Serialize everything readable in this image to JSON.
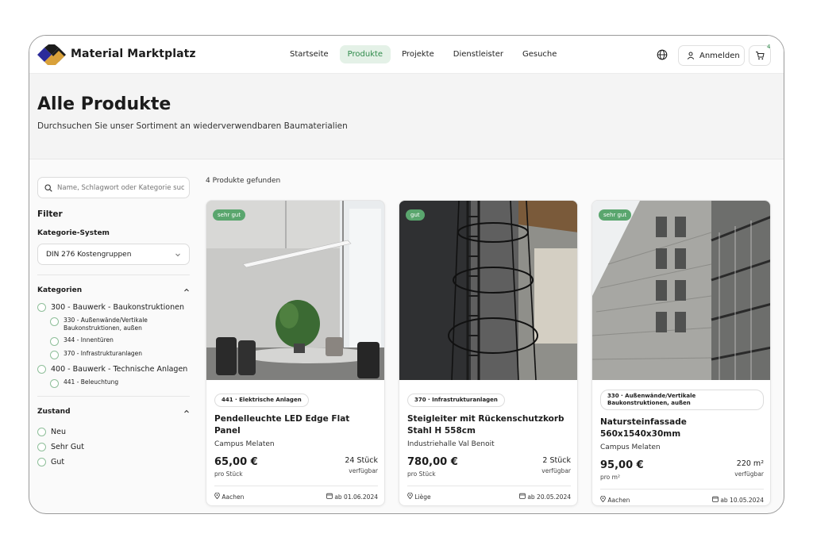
{
  "header": {
    "brand": "Material Marktplatz",
    "nav": [
      "Startseite",
      "Produkte",
      "Projekte",
      "Dienstleister",
      "Gesuche"
    ],
    "active_nav": "Produkte",
    "login_label": "Anmelden",
    "cart_count": "4"
  },
  "hero": {
    "title": "Alle Produkte",
    "subtitle": "Durchsuchen Sie unser Sortiment an wiederverwendbaren Baumaterialien"
  },
  "sidebar": {
    "search_placeholder": "Name, Schlagwort oder Kategorie suchen",
    "filter_title": "Filter",
    "system_label": "Kategorie-System",
    "system_value": "DIN 276 Kostengruppen",
    "categories_label": "Kategorien",
    "categories": [
      {
        "label": "300 - Bauwerk - Baukonstruktionen",
        "children": [
          "330 - Außenwände/Vertikale Baukonstruktionen, außen",
          "344 - Innentüren",
          "370 - Infrastrukturanlagen"
        ]
      },
      {
        "label": "400 - Bauwerk - Technische Anlagen",
        "children": [
          "441 - Beleuchtung"
        ]
      }
    ],
    "condition_label": "Zustand",
    "conditions": [
      "Neu",
      "Sehr Gut",
      "Gut"
    ]
  },
  "results": {
    "count_text": "4 Produkte gefunden",
    "products": [
      {
        "badge": "sehr gut",
        "category": "441 · Elektrische Anlagen",
        "title": "Pendelleuchte LED Edge Flat Panel",
        "location_name": "Campus Melaten",
        "price": "65,00 €",
        "unit": "pro Stück",
        "quantity": "24 Stück",
        "availability": "verfügbar",
        "city": "Aachen",
        "date": "ab 01.06.2024"
      },
      {
        "badge": "gut",
        "category": "370 · Infrastrukturanlagen",
        "title": "Steigleiter mit Rückenschutzkorb Stahl H 558cm",
        "location_name": "Industriehalle Val Benoit",
        "price": "780,00 €",
        "unit": "pro Stück",
        "quantity": "2 Stück",
        "availability": "verfügbar",
        "city": "Liège",
        "date": "ab 20.05.2024"
      },
      {
        "badge": "sehr gut",
        "category": "330 · Außenwände/Vertikale Baukonstruktionen, außen",
        "title": "Natursteinfassade 560x1540x30mm",
        "location_name": "Campus Melaten",
        "price": "95,00 €",
        "unit": "pro m²",
        "quantity": "220 m²",
        "availability": "verfügbar",
        "city": "Aachen",
        "date": "ab 10.05.2024"
      }
    ]
  },
  "colors": {
    "accent": "#5aa66e",
    "accent_text": "#2e8a4a",
    "active_bg": "#e4f1e7"
  }
}
